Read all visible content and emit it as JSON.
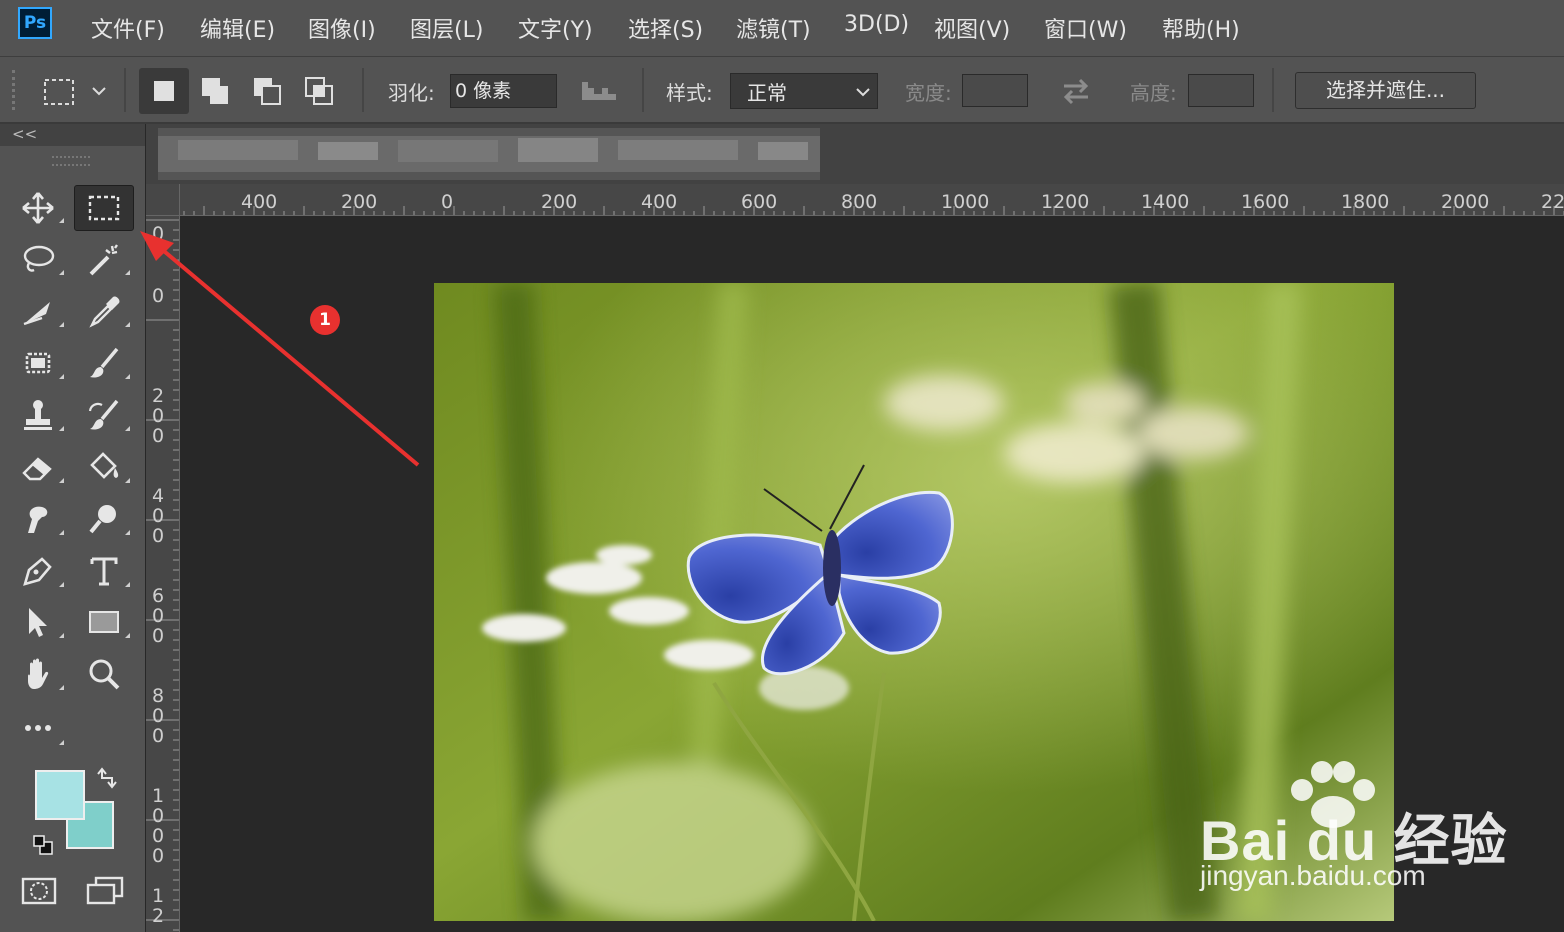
{
  "app": {
    "logo": "Ps"
  },
  "menu": [
    "文件(F)",
    "编辑(E)",
    "图像(I)",
    "图层(L)",
    "文字(Y)",
    "选择(S)",
    "滤镜(T)",
    "3D(D)",
    "视图(V)",
    "窗口(W)",
    "帮助(H)"
  ],
  "options": {
    "feather_label": "羽化:",
    "feather_value": "0 像素",
    "style_label": "样式:",
    "style_value": "正常",
    "width_label": "宽度:",
    "height_label": "高度:",
    "select_mask_button": "选择并遮住..."
  },
  "panel": {
    "collapse_label": "<<"
  },
  "ruler_top": [
    "400",
    "200",
    "0",
    "200",
    "400",
    "600",
    "800",
    "1000",
    "1200",
    "1400",
    "1600",
    "1800",
    "2000",
    "22"
  ],
  "ruler_left": [
    "0",
    "0",
    "2\n0\n0",
    "4\n0\n0",
    "6\n0\n0",
    "8\n0\n0",
    "1\n0\n0\n0",
    "1\n2"
  ],
  "annotation": {
    "step": "1",
    "color": "#e8312f"
  },
  "colors": {
    "foreground": "#a7e2e4",
    "background": "#7fcfca",
    "accent": "#31a8ff"
  },
  "watermark": {
    "brand": "Bai du 经验",
    "url": "jingyan.baidu.com"
  }
}
